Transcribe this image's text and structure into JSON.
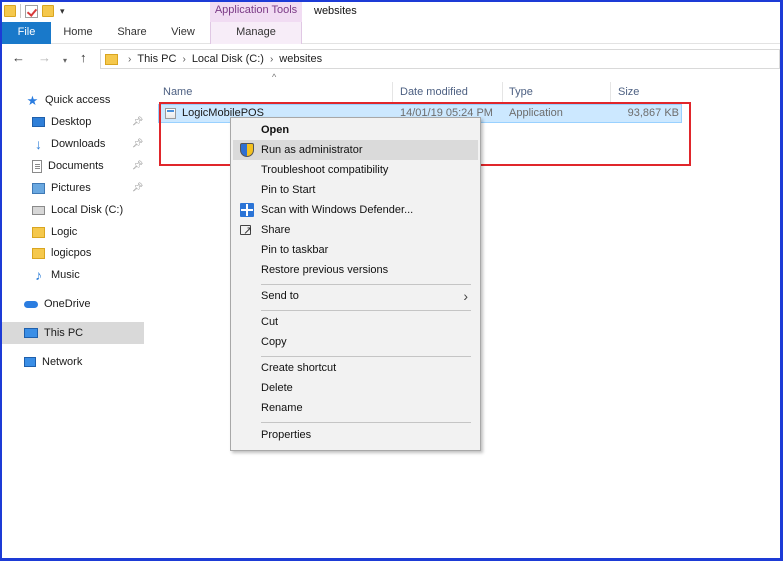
{
  "titlebar": {
    "context_tab_group": "Application Tools",
    "window_title": "websites"
  },
  "ribbon": {
    "tabs": [
      "File",
      "Home",
      "Share",
      "View",
      "Manage"
    ]
  },
  "address": {
    "crumbs": [
      "This PC",
      "Local Disk (C:)",
      "websites"
    ]
  },
  "sidebar": {
    "items": [
      {
        "label": "Quick access",
        "icon": "star-icon"
      },
      {
        "label": "Desktop",
        "icon": "desktop-icon",
        "pinned": true
      },
      {
        "label": "Downloads",
        "icon": "download-icon",
        "pinned": true
      },
      {
        "label": "Documents",
        "icon": "document-icon",
        "pinned": true
      },
      {
        "label": "Pictures",
        "icon": "pictures-icon",
        "pinned": true
      },
      {
        "label": "Local Disk (C:)",
        "icon": "disk-icon"
      },
      {
        "label": "Logic",
        "icon": "folder-icon"
      },
      {
        "label": "logicpos",
        "icon": "folder-icon"
      },
      {
        "label": "Music",
        "icon": "music-icon"
      },
      {
        "label": "OneDrive",
        "icon": "cloud-icon"
      },
      {
        "label": "This PC",
        "icon": "computer-icon",
        "selected": true
      },
      {
        "label": "Network",
        "icon": "network-icon"
      }
    ]
  },
  "filelist": {
    "columns": [
      "Name",
      "Date modified",
      "Type",
      "Size"
    ],
    "rows": [
      {
        "name": "LogicMobilePOS",
        "date": "14/01/19 05:24 PM",
        "type": "Application",
        "size": "93,867 KB"
      }
    ]
  },
  "context_menu": {
    "items": [
      "Open",
      "Run as administrator",
      "Troubleshoot compatibility",
      "Pin to Start",
      "Scan with Windows Defender...",
      "Share",
      "Pin to taskbar",
      "Restore previous versions",
      "Send to",
      "Cut",
      "Copy",
      "Create shortcut",
      "Delete",
      "Rename",
      "Properties"
    ]
  },
  "colors": {
    "accent": "#1979ca",
    "highlight_box": "#e0262b",
    "selection": "#cce8ff"
  }
}
